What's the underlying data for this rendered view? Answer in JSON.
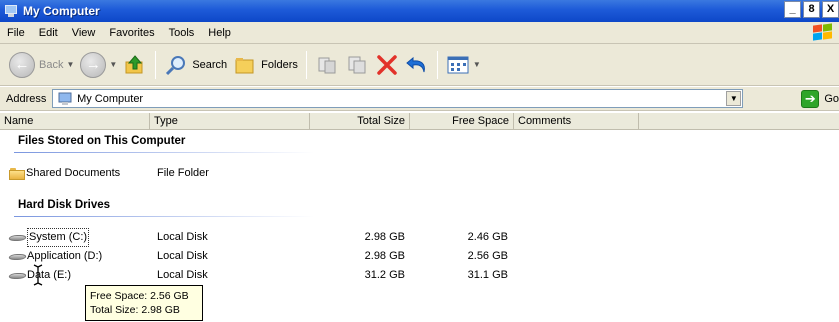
{
  "window": {
    "title": "My Computer",
    "minimize": "_",
    "maximize": "8",
    "close": "X"
  },
  "menu": [
    "File",
    "Edit",
    "View",
    "Favorites",
    "Tools",
    "Help"
  ],
  "toolbar": {
    "back_label": "Back",
    "search_label": "Search",
    "folders_label": "Folders"
  },
  "address": {
    "label": "Address",
    "value": "My Computer",
    "go_label": "Go"
  },
  "columns": [
    "Name",
    "Type",
    "Total Size",
    "Free Space",
    "Comments"
  ],
  "groups": [
    {
      "title": "Files Stored on This Computer",
      "items": [
        {
          "name": "Shared Documents",
          "type": "File Folder",
          "total": "",
          "free": "",
          "icon": "folder-icon"
        }
      ]
    },
    {
      "title": "Hard Disk Drives",
      "items": [
        {
          "name": "System (C:)",
          "type": "Local Disk",
          "total": "2.98 GB",
          "free": "2.46 GB",
          "icon": "disk-icon"
        },
        {
          "name": "Application (D:)",
          "type": "Local Disk",
          "total": "2.98 GB",
          "free": "2.56 GB",
          "icon": "disk-icon"
        },
        {
          "name": "Data (E:)",
          "type": "Local Disk",
          "total": "31.2 GB",
          "free": "31.1 GB",
          "icon": "disk-icon"
        }
      ]
    }
  ],
  "tooltip": {
    "line1": "Free Space: 2.56 GB",
    "line2": "Total Size: 2.98 GB"
  },
  "colors": {
    "titlebar": "#1d5ad8",
    "chrome": "#ece9d8",
    "group_line": "#7a96df",
    "tooltip_bg": "#ffffe1"
  }
}
